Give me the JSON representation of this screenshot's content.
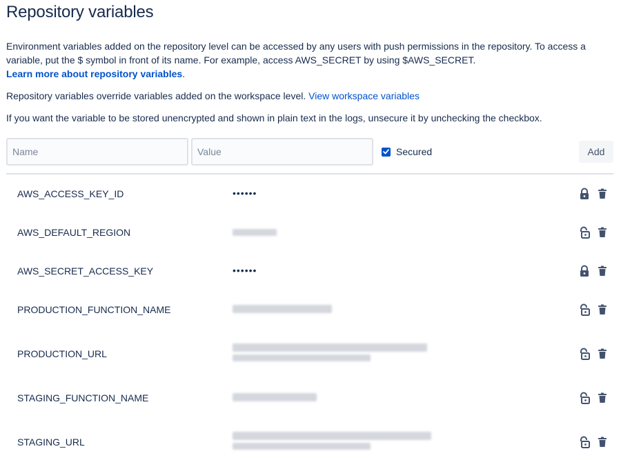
{
  "page_title": "Repository variables",
  "description": {
    "text": "Environment variables added on the repository level can be accessed by any users with push permissions in the repository. To access a variable, put the $ symbol in front of its name. For example, access AWS_SECRET by using $AWS_SECRET.",
    "learn_more_link": "Learn more about repository variables"
  },
  "override": {
    "text": "Repository variables override variables added on the workspace level.",
    "link": "View workspace variables"
  },
  "unsecure_note": "If you want the variable to be stored unencrypted and shown in plain text in the logs, unsecure it by unchecking the checkbox.",
  "form": {
    "name_placeholder": "Name",
    "value_placeholder": "Value",
    "secured_label": "Secured",
    "secured_checked": true,
    "add_label": "Add"
  },
  "colors": {
    "link": "#0052cc",
    "text": "#172b4d",
    "icon": "#42526e",
    "border": "#dfe1e6"
  },
  "variables": [
    {
      "name": "AWS_ACCESS_KEY_ID",
      "secured": true,
      "value_display": "••••••"
    },
    {
      "name": "AWS_DEFAULT_REGION",
      "secured": false,
      "value_display": "redacted"
    },
    {
      "name": "AWS_SECRET_ACCESS_KEY",
      "secured": true,
      "value_display": "••••••"
    },
    {
      "name": "PRODUCTION_FUNCTION_NAME",
      "secured": false,
      "value_display": "redacted"
    },
    {
      "name": "PRODUCTION_URL",
      "secured": false,
      "value_display": "redacted"
    },
    {
      "name": "STAGING_FUNCTION_NAME",
      "secured": false,
      "value_display": "redacted"
    },
    {
      "name": "STAGING_URL",
      "secured": false,
      "value_display": "redacted"
    }
  ],
  "icons": {
    "secured": "lock-closed-icon",
    "unsecured": "lock-open-icon",
    "delete": "trash-icon"
  }
}
